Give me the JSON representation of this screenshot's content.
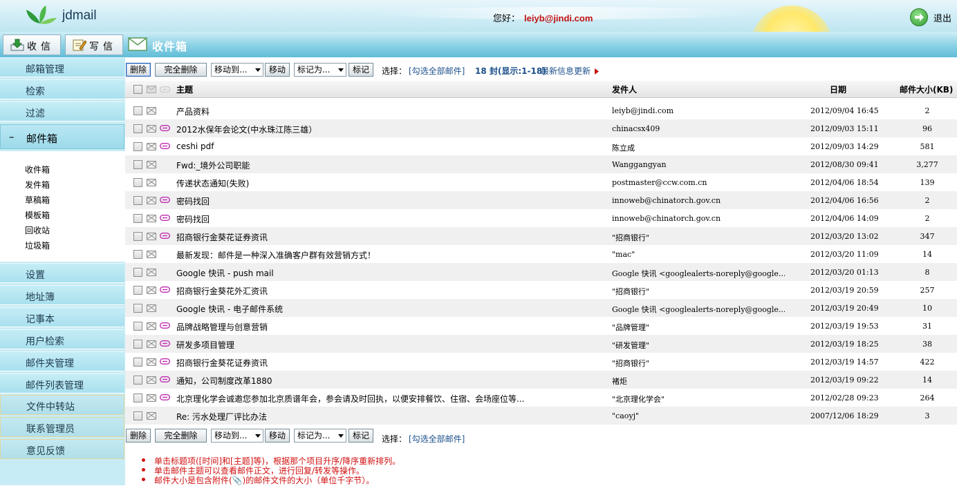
{
  "header": {
    "app_name": "jdmail",
    "greeting_label": "您好：",
    "user_email": "leiyb@jindi.com",
    "logout_label": "退出"
  },
  "toolbar": {
    "receive_label": "收信",
    "compose_label": "写信",
    "folder_title": "收件箱"
  },
  "sidebar": {
    "items_top": [
      {
        "label": "邮箱管理"
      },
      {
        "label": "检索"
      },
      {
        "label": "过滤"
      }
    ],
    "expanded": {
      "label": "邮件箱",
      "toggle": "–"
    },
    "folders": [
      {
        "label": "收件箱"
      },
      {
        "label": "发件箱"
      },
      {
        "label": "草稿箱"
      },
      {
        "label": "模板箱"
      },
      {
        "label": "回收站"
      },
      {
        "label": "垃圾箱"
      }
    ],
    "items_bottom": [
      {
        "label": "设置"
      },
      {
        "label": "地址簿"
      },
      {
        "label": "记事本"
      },
      {
        "label": "用户检索"
      },
      {
        "label": "邮件夹管理"
      },
      {
        "label": "邮件列表管理"
      },
      {
        "label": "文件中转站"
      },
      {
        "label": "联系管理员"
      },
      {
        "label": "意见反馈"
      }
    ]
  },
  "actions": {
    "delete": "删除",
    "delete_all": "完全删除",
    "move_to": "移动到...",
    "move": "移动",
    "mark_as": "标记为...",
    "mark": "标记",
    "select_label": "选择：",
    "select_all": "[勾选全部邮件]",
    "count_text": "18 封(显示:1-18)",
    "latest_label": "最新信息更新"
  },
  "table": {
    "headers": {
      "subject": "主题",
      "sender": "发件人",
      "date": "日期",
      "size": "邮件大小(KB)"
    },
    "rows": [
      {
        "subject": "产品资料",
        "sender": "leiyb@jindi.com",
        "date": "2012/09/04 16:45",
        "size": "2",
        "attach": false
      },
      {
        "subject": "2012水保年会论文(中水珠江陈三雄）",
        "sender": "chinacsx409",
        "date": "2012/09/03 15:11",
        "size": "96",
        "attach": true
      },
      {
        "subject": "ceshi pdf",
        "sender": "陈立成",
        "date": "2012/09/03 14:29",
        "size": "581",
        "attach": true
      },
      {
        "subject": "Fwd:_境外公司职能",
        "sender": "Wanggangyan",
        "date": "2012/08/30 09:41",
        "size": "3,277",
        "attach": false
      },
      {
        "subject": "传递状态通知(失败)",
        "sender": "postmaster@ccw.com.cn",
        "date": "2012/04/06 18:54",
        "size": "139",
        "attach": false
      },
      {
        "subject": "密码找回",
        "sender": "innoweb@chinatorch.gov.cn",
        "date": "2012/04/06 16:56",
        "size": "2",
        "attach": true
      },
      {
        "subject": "密码找回",
        "sender": "innoweb@chinatorch.gov.cn",
        "date": "2012/04/06 14:09",
        "size": "2",
        "attach": true
      },
      {
        "subject": "招商银行金葵花证券资讯",
        "sender": "\"招商银行\"",
        "date": "2012/03/20 13:02",
        "size": "347",
        "attach": true
      },
      {
        "subject": "最新发现：邮件是一种深入准确客户群有效营销方式！",
        "sender": "\"mac\"",
        "date": "2012/03/20 11:09",
        "size": "14",
        "attach": false
      },
      {
        "subject": "Google 快讯 - push mail",
        "sender": "Google 快讯 <googlealerts-noreply@google...",
        "date": "2012/03/20 01:13",
        "size": "8",
        "attach": false
      },
      {
        "subject": "招商银行金葵花外汇资讯",
        "sender": "\"招商银行\"",
        "date": "2012/03/19 20:59",
        "size": "257",
        "attach": true
      },
      {
        "subject": "Google 快讯 - 电子邮件系统",
        "sender": "Google 快讯 <googlealerts-noreply@google...",
        "date": "2012/03/19 20:49",
        "size": "10",
        "attach": false
      },
      {
        "subject": "品牌战略管理与创意营销",
        "sender": "\"品牌管理\"",
        "date": "2012/03/19 19:53",
        "size": "31",
        "attach": true
      },
      {
        "subject": "研发多项目管理",
        "sender": "\"研发管理\"",
        "date": "2012/03/19 18:25",
        "size": "38",
        "attach": true
      },
      {
        "subject": "招商银行金葵花证券资讯",
        "sender": "\"招商银行\"",
        "date": "2012/03/19 14:57",
        "size": "422",
        "attach": true
      },
      {
        "subject": "通知，公司制度改革1880",
        "sender": "褚炬",
        "date": "2012/03/19 09:22",
        "size": "14",
        "attach": true
      },
      {
        "subject": "北京理化学会诚邀您参加北京质谱年会，参会请及时回执，以便安排餐饮、住宿、会场座位等...",
        "sender": "\"北京理化学会\"",
        "date": "2012/02/28 09:23",
        "size": "264",
        "attach": true
      },
      {
        "subject": "Re: 污水处理厂评比办法",
        "sender": "\"caoyj\"",
        "date": "2007/12/06 18:29",
        "size": "3",
        "attach": false
      }
    ]
  },
  "notes": [
    "单击标题项([时间]和[主题]等)，根据那个项目升序/降序重新排列。",
    "单击邮件主题可以查看邮件正文，进行回复/转发等操作。",
    "邮件大小是包含附件(📎)的邮件文件的大小（单位千字节）。"
  ],
  "colors": {
    "accent": "#5fbdd8",
    "sidebar": "#a9e0ee",
    "email_highlight": "#c01010",
    "link": "#1b4f8a",
    "attach": "#c02ab0"
  }
}
